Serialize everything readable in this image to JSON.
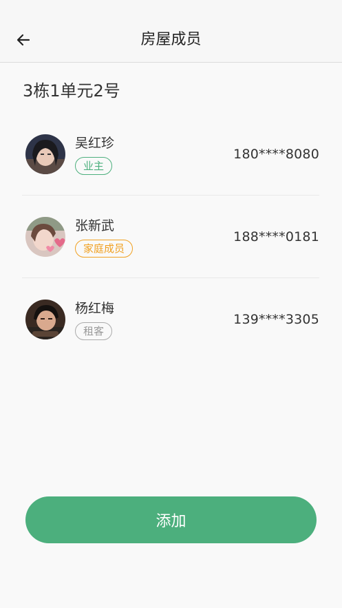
{
  "nav": {
    "title": "房屋成员"
  },
  "house": {
    "title": "3栋1单元2号"
  },
  "members": [
    {
      "name": "吴红珍",
      "role": "业主",
      "phone": "180****8080"
    },
    {
      "name": "张新武",
      "role": "家庭成员",
      "phone": "188****0181"
    },
    {
      "name": "杨红梅",
      "role": "租客",
      "phone": "139****3305"
    }
  ],
  "actions": {
    "add_label": "添加"
  },
  "colors": {
    "accent": "#4caf7d",
    "family_badge": "#f0a020",
    "tenant_badge": "#999999"
  },
  "icons": {
    "back": "arrow-left-icon"
  }
}
